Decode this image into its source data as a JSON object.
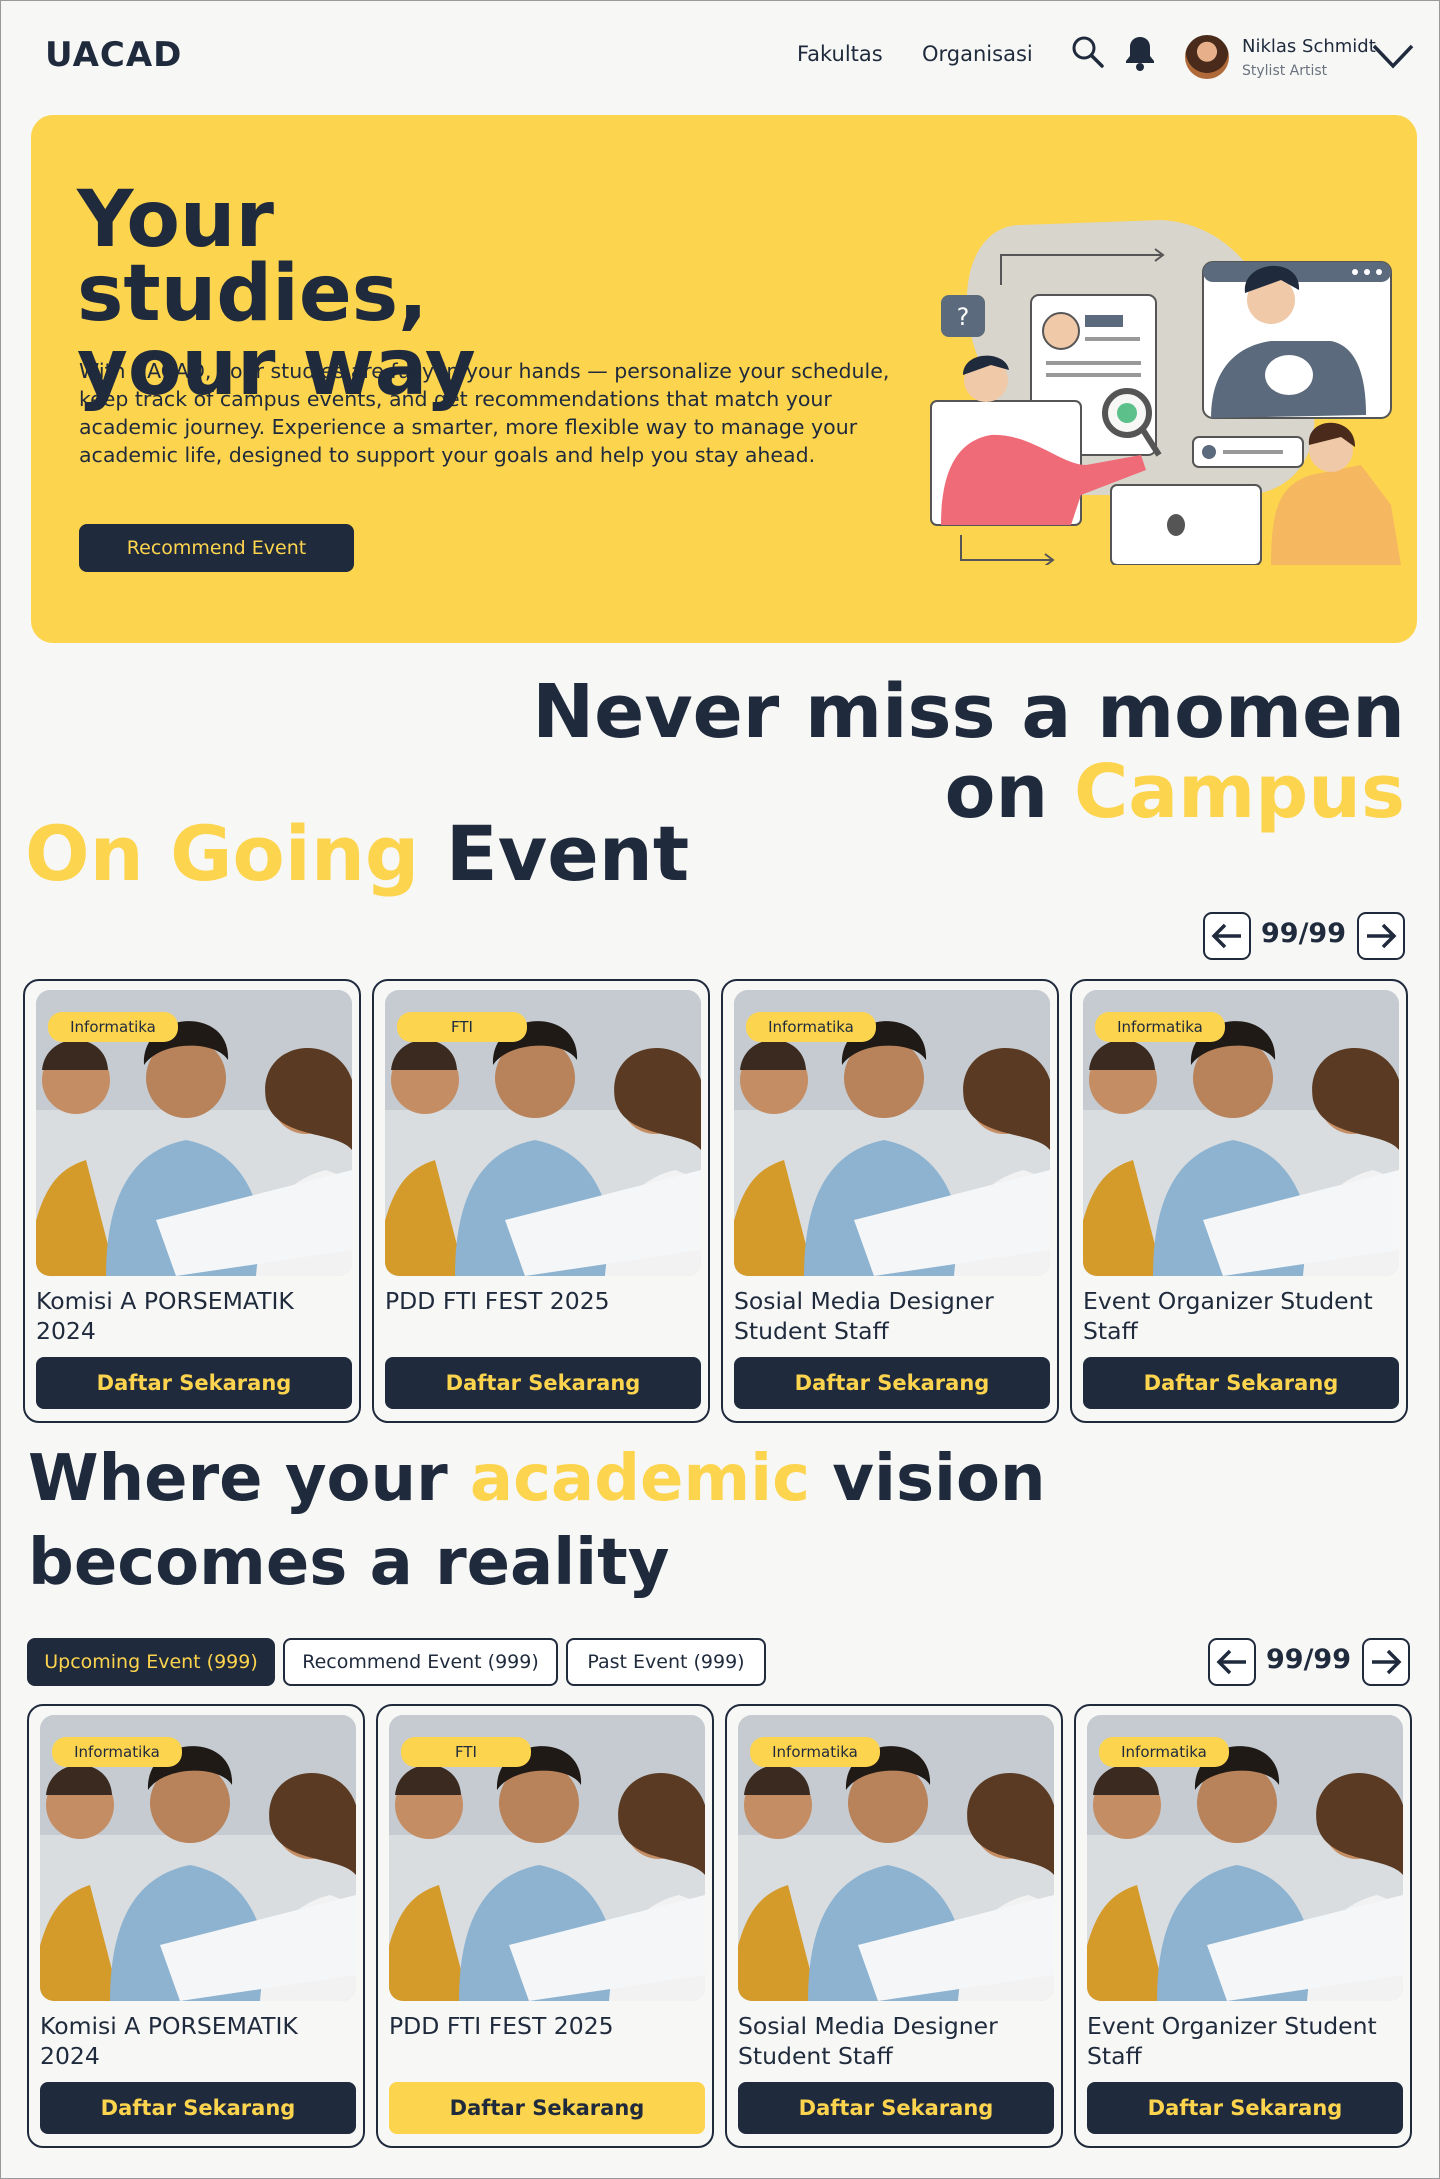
{
  "nav": {
    "logo": "UACAD",
    "links": [
      "Fakultas",
      "Organisasi"
    ],
    "user": {
      "name": "Niklas Schmidt",
      "role": "Stylist Artist"
    }
  },
  "hero": {
    "title_line1": "Your studies,",
    "title_line2": "your way",
    "description": "With UACAD, your studies are fully in your hands — personalize your schedule, keep track of campus events, and get recommendations that match your academic journey. Experience a smarter, more flexible way to manage your academic life, designed to support your goals and help you stay ahead.",
    "button": "Recommend Event",
    "illustration_mark": "?"
  },
  "section1": {
    "line1": "Never miss a momen",
    "line2_a": "on",
    "line2_b": "Campus",
    "subtitle_a": "On Going",
    "subtitle_b": "Event",
    "pager": "99/99"
  },
  "ongoing_cards": [
    {
      "tag": "Informatika",
      "title": "Komisi A PORSEMATIK 2024",
      "button": "Daftar Sekarang"
    },
    {
      "tag": "FTI",
      "title": "PDD FTI FEST 2025",
      "button": "Daftar Sekarang"
    },
    {
      "tag": "Informatika",
      "title": "Sosial Media Designer Student Staff",
      "button": "Daftar Sekarang"
    },
    {
      "tag": "Informatika",
      "title": "Event Organizer Student Staff",
      "button": "Daftar Sekarang"
    }
  ],
  "section2": {
    "line1_a": "Where your",
    "line1_b": "academic",
    "line1_c": "vision",
    "line2": "becomes a reality",
    "tabs": [
      "Upcoming Event (999)",
      "Recommend Event  (999)",
      "Past Event  (999)"
    ],
    "pager": "99/99"
  },
  "event_cards": [
    {
      "tag": "Informatika",
      "title": "Komisi A PORSEMATIK 2024",
      "button": "Daftar Sekarang"
    },
    {
      "tag": "FTI",
      "title": "PDD FTI FEST 2025",
      "button": "Daftar Sekarang"
    },
    {
      "tag": "Informatika",
      "title": "Sosial Media Designer Student Staff",
      "button": "Daftar Sekarang"
    },
    {
      "tag": "Informatika",
      "title": "Event Organizer Student Staff",
      "button": "Daftar Sekarang"
    }
  ],
  "colors": {
    "accent": "#fdd44e",
    "dark": "#1f2a3c",
    "background": "#f7f7f5"
  }
}
